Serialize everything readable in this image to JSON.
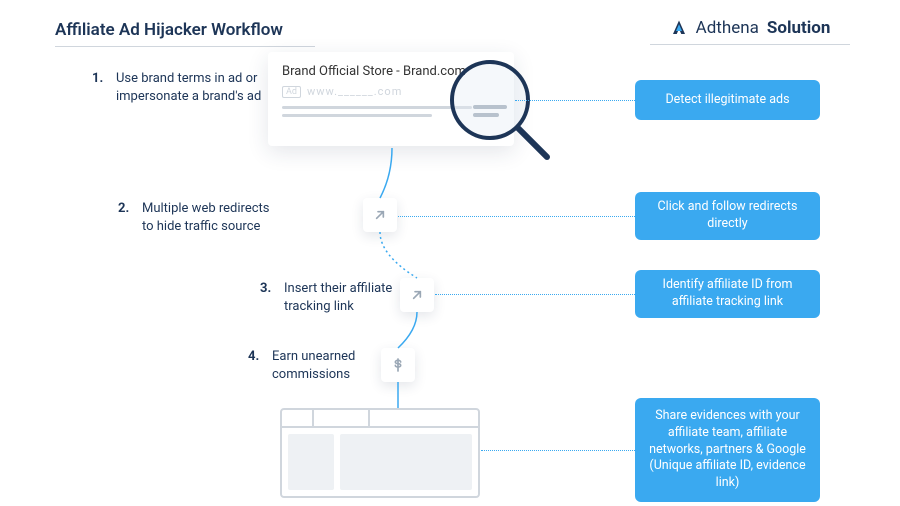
{
  "workflow_title": "Affiliate Ad Hijacker Workflow",
  "solution": {
    "brand": "Adthena",
    "word": "Solution"
  },
  "steps": {
    "s1": {
      "num": "1.",
      "text": "Use brand terms in ad or impersonate a brand's ad"
    },
    "s2": {
      "num": "2.",
      "text": "Multiple web redirects to hide traffic source"
    },
    "s3": {
      "num": "3.",
      "text": "Insert their affiliate tracking link"
    },
    "s4": {
      "num": "4.",
      "text": "Earn unearned commissions"
    }
  },
  "solutions": {
    "p1": "Detect illegitimate ads",
    "p2": "Click and follow redirects directly",
    "p3": "Identify affiliate ID from affiliate tracking link",
    "p4": "Share evidences with your affiliate team, affiliate networks, partners & Google (Unique affiliate ID, evidence link)"
  },
  "ad": {
    "headline": "Brand Official Store - Brand.com",
    "label": "Ad",
    "url": "www.______.com"
  }
}
